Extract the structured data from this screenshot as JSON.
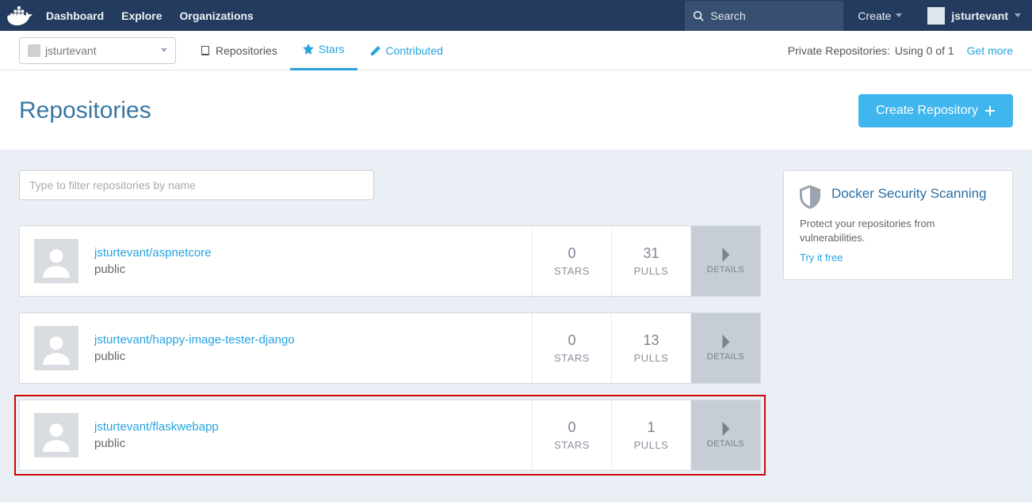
{
  "nav": {
    "links": [
      "Dashboard",
      "Explore",
      "Organizations"
    ],
    "search_placeholder": "Search",
    "create_label": "Create",
    "username": "jsturtevant"
  },
  "subbar": {
    "owner": "jsturtevant",
    "tabs": {
      "repositories": "Repositories",
      "stars": "Stars",
      "contributed": "Contributed"
    },
    "private_label": "Private Repositories:",
    "private_usage": "Using 0 of 1",
    "get_more": "Get more"
  },
  "page": {
    "title": "Repositories",
    "create_button": "Create Repository",
    "filter_placeholder": "Type to filter repositories by name"
  },
  "labels": {
    "stars": "STARS",
    "pulls": "PULLS",
    "details": "DETAILS"
  },
  "repos": [
    {
      "name": "jsturtevant/aspnetcore",
      "visibility": "public",
      "stars": 0,
      "pulls": 31,
      "highlighted": false
    },
    {
      "name": "jsturtevant/happy-image-tester-django",
      "visibility": "public",
      "stars": 0,
      "pulls": 13,
      "highlighted": false
    },
    {
      "name": "jsturtevant/flaskwebapp",
      "visibility": "public",
      "stars": 0,
      "pulls": 1,
      "highlighted": true
    }
  ],
  "sidebar": {
    "title": "Docker Security Scanning",
    "body": "Protect your repositories from vulnerabilities.",
    "try": "Try it free"
  }
}
